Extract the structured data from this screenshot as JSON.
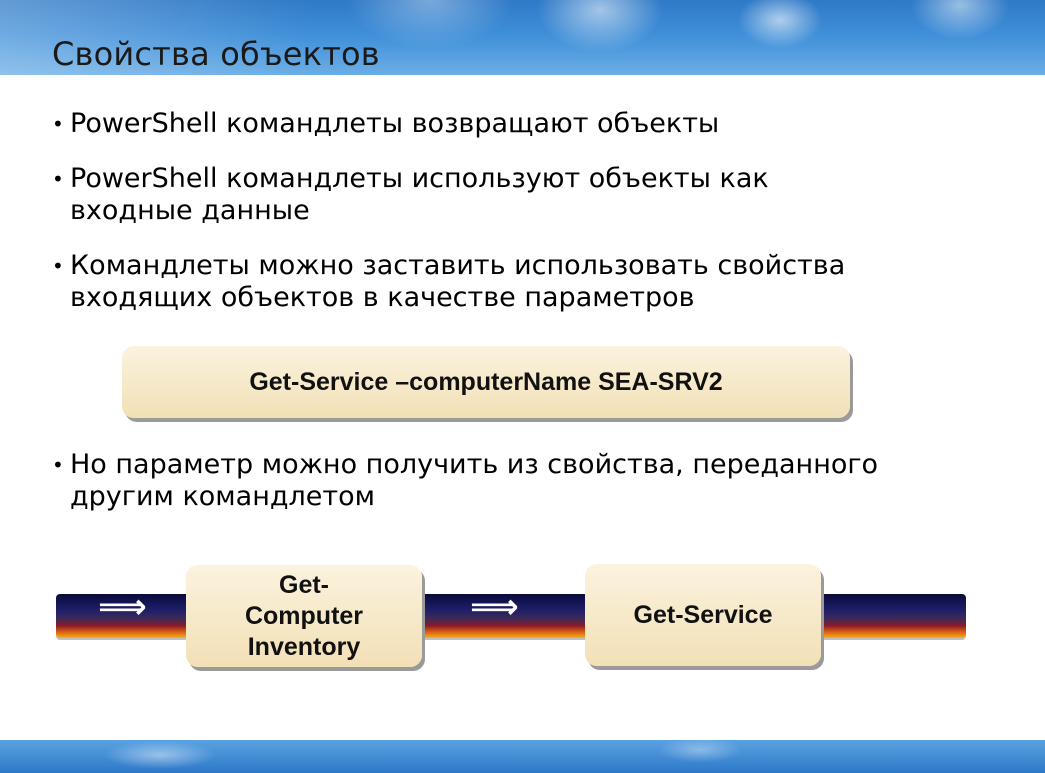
{
  "slide": {
    "title": "Свойства объектов",
    "bullets": [
      {
        "marker": "•",
        "text": "PowerShell командлеты возвращают объекты"
      },
      {
        "marker": "•",
        "line1": "PowerShell командлеты используют объекты как",
        "line2": "входные данные"
      },
      {
        "marker": "•",
        "line1": "Командлеты можно заставить использовать свойства",
        "line2": "входящих объектов в качестве параметров"
      },
      {
        "marker": "•",
        "line1": "Но параметр можно получить из свойства, переданного",
        "line2": "другим командлетом"
      }
    ],
    "command_example": "Get-Service –computerName SEA-SRV2",
    "pipeline": {
      "arrow_glyph": "⟹",
      "box1_lines": [
        "Get-",
        "Computer",
        "Inventory"
      ],
      "box2": "Get-Service"
    }
  }
}
